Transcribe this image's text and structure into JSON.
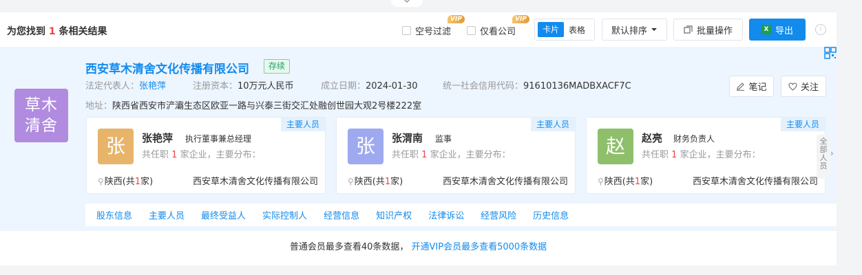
{
  "header": {
    "found_prefix": "为您找到",
    "found_count": "1",
    "found_suffix": "条相关结果",
    "filter_empty_label": "空号过滤",
    "filter_view_company_label": "仅看公司",
    "vip_badge": "VIP",
    "view_card_label": "卡片",
    "view_table_label": "表格",
    "sort_label": "默认排序",
    "batch_label": "批量操作",
    "export_label": "导出",
    "info_icon": "i"
  },
  "company": {
    "logo_line1": "草木",
    "logo_line2": "清舍",
    "name": "西安草木清舍文化传播有限公司",
    "status": "存续",
    "legal_rep_label": "法定代表人：",
    "legal_rep": "张艳萍",
    "capital_label": "注册资本：",
    "capital": "10万元人民币",
    "founded_label": "成立日期：",
    "founded": "2024-01-30",
    "credit_code_label": "统一社会信用代码：",
    "credit_code": "91610136MADBXACF7C",
    "address_label": "地址：",
    "address": "陕西省西安市浐灞生态区欧亚一路与兴泰三街交汇处融创世园大观2号楼222室",
    "note_label": "笔记",
    "follow_label": "关注",
    "more_staff": [
      "全",
      "部",
      "人",
      "员"
    ],
    "more_staff_arrow": "›"
  },
  "people": [
    {
      "avatar": "张",
      "avatar_color": "#e8b46a",
      "name": "张艳萍",
      "role": "执行董事兼总经理",
      "tag": "主要人员",
      "stat_prefix": "共任职",
      "stat_count": "1",
      "stat_suffix": "家企业，主要分布：",
      "region": "陕西(共",
      "region_count": "1",
      "region_suffix": "家)",
      "company": "西安草木清舍文化传播有限公司"
    },
    {
      "avatar": "张",
      "avatar_color": "#9ea9ef",
      "name": "张渭南",
      "role": "监事",
      "tag": "主要人员",
      "stat_prefix": "共任职",
      "stat_count": "1",
      "stat_suffix": "家企业，主要分布：",
      "region": "陕西(共",
      "region_count": "1",
      "region_suffix": "家)",
      "company": "西安草木清舍文化传播有限公司"
    },
    {
      "avatar": "赵",
      "avatar_color": "#8fbf6a",
      "name": "赵亮",
      "role": "财务负责人",
      "tag": "主要人员",
      "stat_prefix": "共任职",
      "stat_count": "1",
      "stat_suffix": "家企业，主要分布：",
      "region": "陕西(共",
      "region_count": "1",
      "region_suffix": "家)",
      "company": "西安草木清舍文化传播有限公司"
    }
  ],
  "tabs": [
    "股东信息",
    "主要人员",
    "最终受益人",
    "实际控制人",
    "经营信息",
    "知识产权",
    "法律诉讼",
    "经营风险",
    "历史信息"
  ],
  "footer": {
    "text": "普通会员最多查看40条数据，",
    "link": "开通VIP会员最多查看5000条数据"
  }
}
